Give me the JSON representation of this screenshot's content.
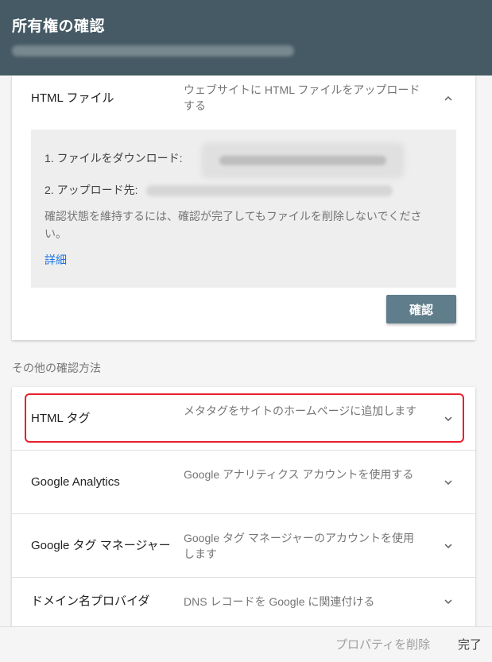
{
  "header": {
    "title": "所有権の確認"
  },
  "expanded_method": {
    "name": "HTML ファイル",
    "description": "ウェブサイトに HTML ファイルをアップロードする",
    "step1_label": "1. ファイルをダウンロード:",
    "step2_label": "2. アップロード先:",
    "note": "確認状態を維持するには、確認が完了してもファイルを削除しないでください。",
    "details_link": "詳細",
    "confirm_label": "確認"
  },
  "other_methods": {
    "section_title": "その他の確認方法",
    "items": [
      {
        "name": "HTML タグ",
        "description": "メタタグをサイトのホームページに追加します",
        "highlighted": true
      },
      {
        "name": "Google Analytics",
        "description": "Google アナリティクス アカウントを使用する"
      },
      {
        "name": "Google タグ マネージャー",
        "description": "Google タグ マネージャーのアカウントを使用します"
      },
      {
        "name": "ドメイン名プロバイダ",
        "description": "DNS レコードを Google に関連付ける"
      }
    ]
  },
  "footer": {
    "remove_label": "プロパティを削除",
    "done_label": "完了"
  },
  "icons": {
    "expand": "chevron-down-icon",
    "collapse": "chevron-up-icon"
  },
  "colors": {
    "header_bg": "#455a64",
    "button_bg": "#607d8b",
    "link": "#1a73e8",
    "highlight_border": "#e8202a"
  }
}
